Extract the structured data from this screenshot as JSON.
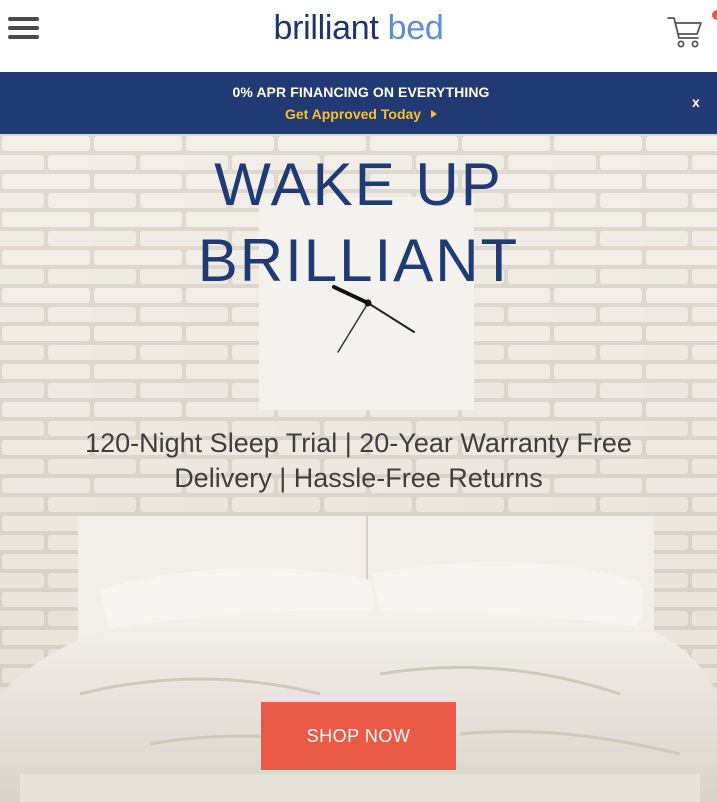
{
  "header": {
    "logo_word1": "brilliant",
    "logo_word2": "bed",
    "logo_colors": {
      "word1": "#1f3468",
      "word2": "#5b8fd1"
    },
    "menu_icon": "hamburger-menu-icon",
    "cart_icon": "shopping-cart-icon",
    "cart_badge_color": "#ea5a3e"
  },
  "promo": {
    "title": "0% APR FINANCING ON EVERYTHING",
    "link_label": "Get Approved Today",
    "link_icon": "play-arrow-icon",
    "close_label": "x",
    "background_color": "#213a73",
    "link_color": "#f5c132"
  },
  "hero": {
    "headline_line1": "WAKE UP",
    "headline_line2": "BRILLIANT",
    "features_line1": "120-Night Sleep Trial | 20-Year Warranty Free",
    "features_line2": "Delivery | Hassle-Free Returns",
    "cta_label": "SHOP NOW",
    "cta_color": "#ea5a47",
    "headline_color": "#213a73"
  }
}
